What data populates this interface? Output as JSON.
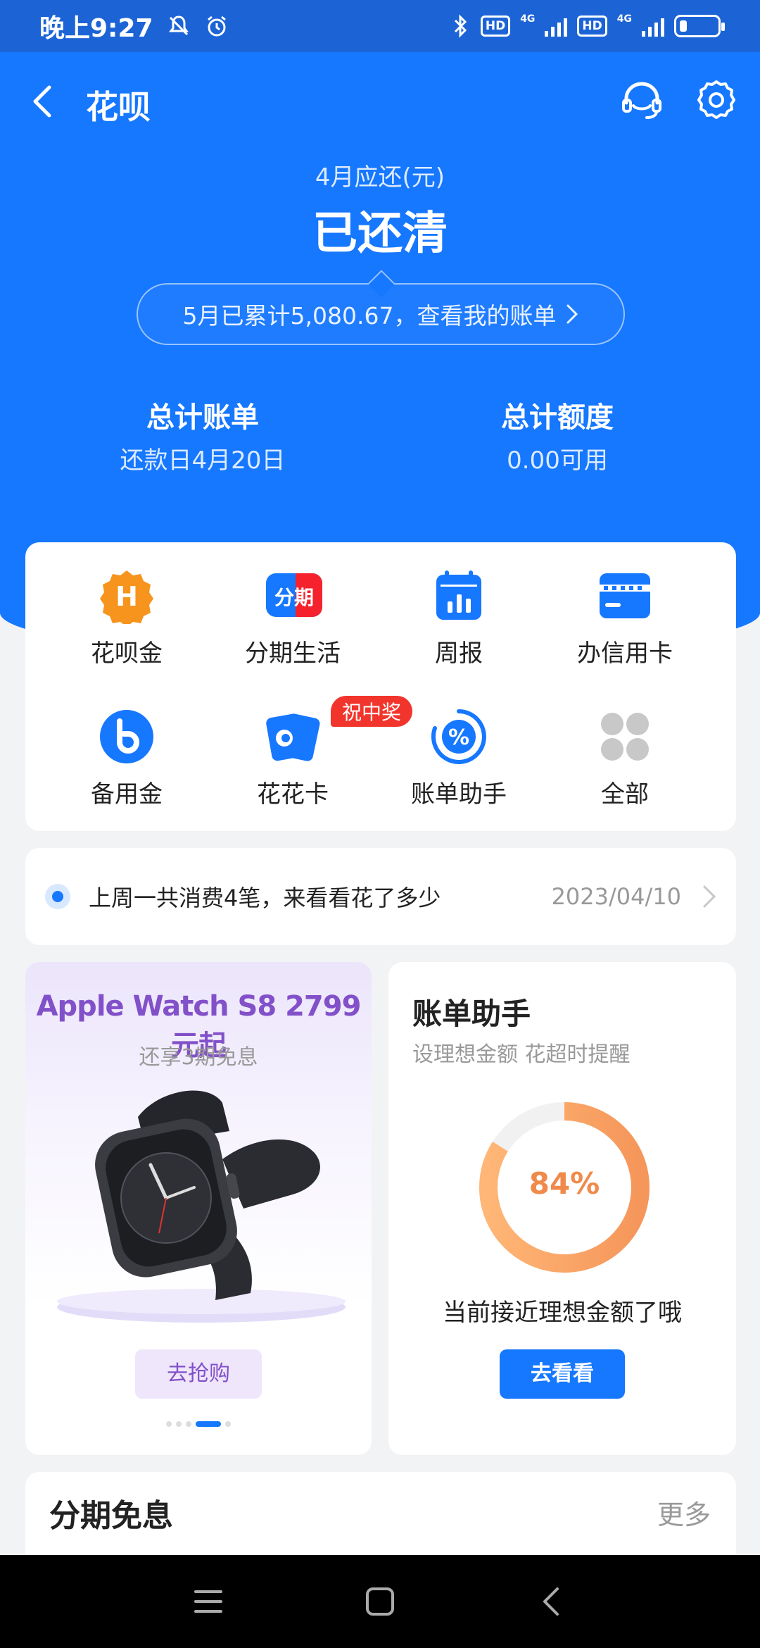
{
  "status_bar": {
    "time": "晚上9:27",
    "hd1": "HD",
    "net1": "4G",
    "hd2": "HD",
    "net2": "4G"
  },
  "nav": {
    "title": "花呗"
  },
  "summary": {
    "due_label": "4月应还(元)",
    "due_status": "已还清",
    "bill_text": "5月已累计5,080.67，查看我的账单",
    "total_bill_title": "总计账单",
    "total_bill_sub": "还款日4月20日",
    "total_limit_title": "总计额度",
    "total_limit_sub": "0.00可用"
  },
  "grid": {
    "items": [
      {
        "label": "花呗金",
        "icon": "huabei-gold-icon"
      },
      {
        "label": "分期生活",
        "icon": "installment-icon"
      },
      {
        "label": "周报",
        "icon": "weekly-report-icon"
      },
      {
        "label": "办信用卡",
        "icon": "credit-card-icon"
      },
      {
        "label": "备用金",
        "icon": "reserve-fund-icon"
      },
      {
        "label": "花花卡",
        "icon": "huahua-card-icon"
      },
      {
        "label": "账单助手",
        "icon": "bill-helper-icon"
      },
      {
        "label": "全部",
        "icon": "all-apps-icon"
      }
    ],
    "badge": "祝中奖",
    "icon_icons": {
      "gold_glyph": "H",
      "installment_glyph": "分期"
    }
  },
  "weekly": {
    "text": "上周一共消费4笔，来看看花了多少",
    "date": "2023/04/10"
  },
  "promo": {
    "title": "Apple Watch S8 2799元起",
    "subtitle": "还享3期免息",
    "button": "去抢购"
  },
  "helper": {
    "title": "账单助手",
    "subtitle": "设理想金额 花超时提醒",
    "percent_text": "84%",
    "percent": 0.84,
    "message": "当前接近理想金额了哦",
    "button": "去看看"
  },
  "free_interest": {
    "title": "分期免息",
    "more": "更多"
  },
  "colors": {
    "brand_blue": "#1677ff",
    "promo_purple": "#8250c8",
    "ring_orange": "#f5965a",
    "badge_red": "#f2352c"
  }
}
